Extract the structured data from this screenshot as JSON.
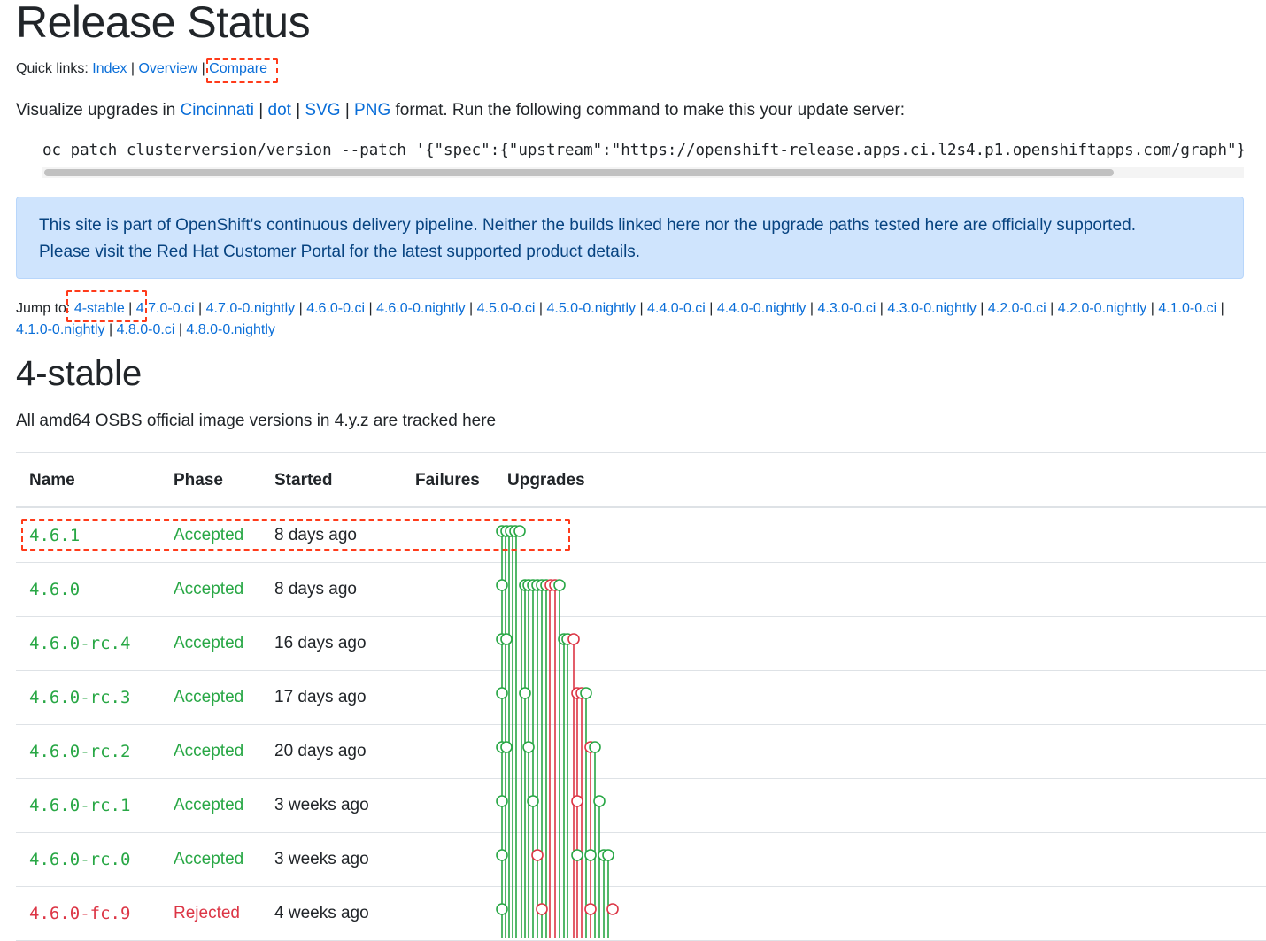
{
  "title": "Release Status",
  "quick_links": {
    "label": "Quick links:",
    "items": [
      "Index",
      "Overview",
      "Compare"
    ]
  },
  "intro": {
    "prefix": "Visualize upgrades in",
    "links": [
      "Cincinnati",
      "dot",
      "SVG",
      "PNG"
    ],
    "suffix": "format. Run the following command to make this your update server:"
  },
  "command": "oc patch clusterversion/version --patch '{\"spec\":{\"upstream\":\"https://openshift-release.apps.ci.l2s4.p1.openshiftapps.com/graph\"}}' --type=merge",
  "alert": {
    "line1": "This site is part of OpenShift's continuous delivery pipeline. Neither the builds linked here nor the upgrade paths tested here are officially supported.",
    "line2": "Please visit the Red Hat Customer Portal for the latest supported product details."
  },
  "jump": {
    "label": "Jump to:",
    "items": [
      "4-stable",
      "4.7.0-0.ci",
      "4.7.0-0.nightly",
      "4.6.0-0.ci",
      "4.6.0-0.nightly",
      "4.5.0-0.ci",
      "4.5.0-0.nightly",
      "4.4.0-0.ci",
      "4.4.0-0.nightly",
      "4.3.0-0.ci",
      "4.3.0-0.nightly",
      "4.2.0-0.ci",
      "4.2.0-0.nightly",
      "4.1.0-0.ci",
      "4.1.0-0.nightly",
      "4.8.0-0.ci",
      "4.8.0-0.nightly"
    ]
  },
  "section": {
    "title": "4-stable",
    "description": "All amd64 OSBS official image versions in 4.y.z are tracked here"
  },
  "table": {
    "headers": {
      "name": "Name",
      "phase": "Phase",
      "started": "Started",
      "failures": "Failures",
      "upgrades": "Upgrades"
    },
    "rows": [
      {
        "name": "4.6.1",
        "phase": "Accepted",
        "started": "8 days ago"
      },
      {
        "name": "4.6.0",
        "phase": "Accepted",
        "started": "8 days ago"
      },
      {
        "name": "4.6.0-rc.4",
        "phase": "Accepted",
        "started": "16 days ago"
      },
      {
        "name": "4.6.0-rc.3",
        "phase": "Accepted",
        "started": "17 days ago"
      },
      {
        "name": "4.6.0-rc.2",
        "phase": "Accepted",
        "started": "20 days ago"
      },
      {
        "name": "4.6.0-rc.1",
        "phase": "Accepted",
        "started": "3 weeks ago"
      },
      {
        "name": "4.6.0-rc.0",
        "phase": "Accepted",
        "started": "3 weeks ago"
      },
      {
        "name": "4.6.0-fc.9",
        "phase": "Rejected",
        "started": "4 weeks ago"
      }
    ]
  },
  "colors": {
    "accepted": "#28a745",
    "rejected": "#dc3545",
    "link": "#0a6ed8",
    "highlight": "#ff3b1a"
  }
}
